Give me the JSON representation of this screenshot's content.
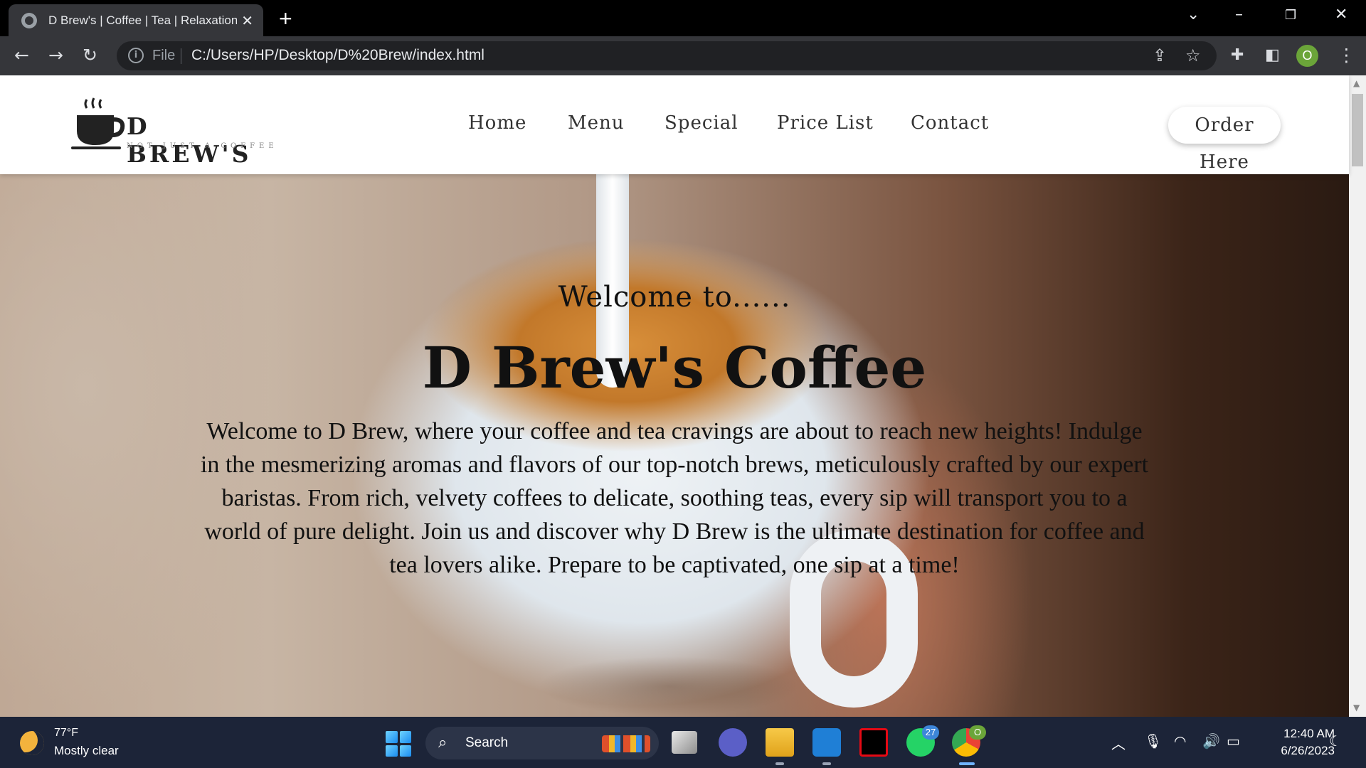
{
  "browser": {
    "tab_title": "D Brew's | Coffee | Tea | Relaxation",
    "new_tab_symbol": "+",
    "address_prefix": "File",
    "url": "C:/Users/HP/Desktop/D%20Brew/index.html",
    "profile_initial": "O"
  },
  "site": {
    "logo_name": "D BREW'S",
    "logo_tagline": "NOT JUST A COFFEE",
    "nav": [
      "Home",
      "Menu",
      "Special",
      "Price List",
      "Contact"
    ],
    "order_button": "Order Here"
  },
  "hero": {
    "welcome": "Welcome to......",
    "title": "D Brew's Coffee",
    "description": "Welcome to D Brew, where your coffee and tea cravings are about to reach new heights! Indulge in the mesmerizing aromas and flavors of our top-notch brews, meticulously crafted by our expert baristas. From rich, velvety coffees to delicate, soothing teas, every sip will transport you to a world of pure delight. Join us and discover why D Brew is the ultimate destination for coffee and tea lovers alike. Prepare to be captivated, one sip at a time!"
  },
  "taskbar": {
    "weather_temp": "77°F",
    "weather_desc": "Mostly clear",
    "search_label": "Search",
    "whatsapp_badge": "27",
    "chrome_badge": "O",
    "time": "12:40 AM",
    "date": "6/26/2023"
  }
}
